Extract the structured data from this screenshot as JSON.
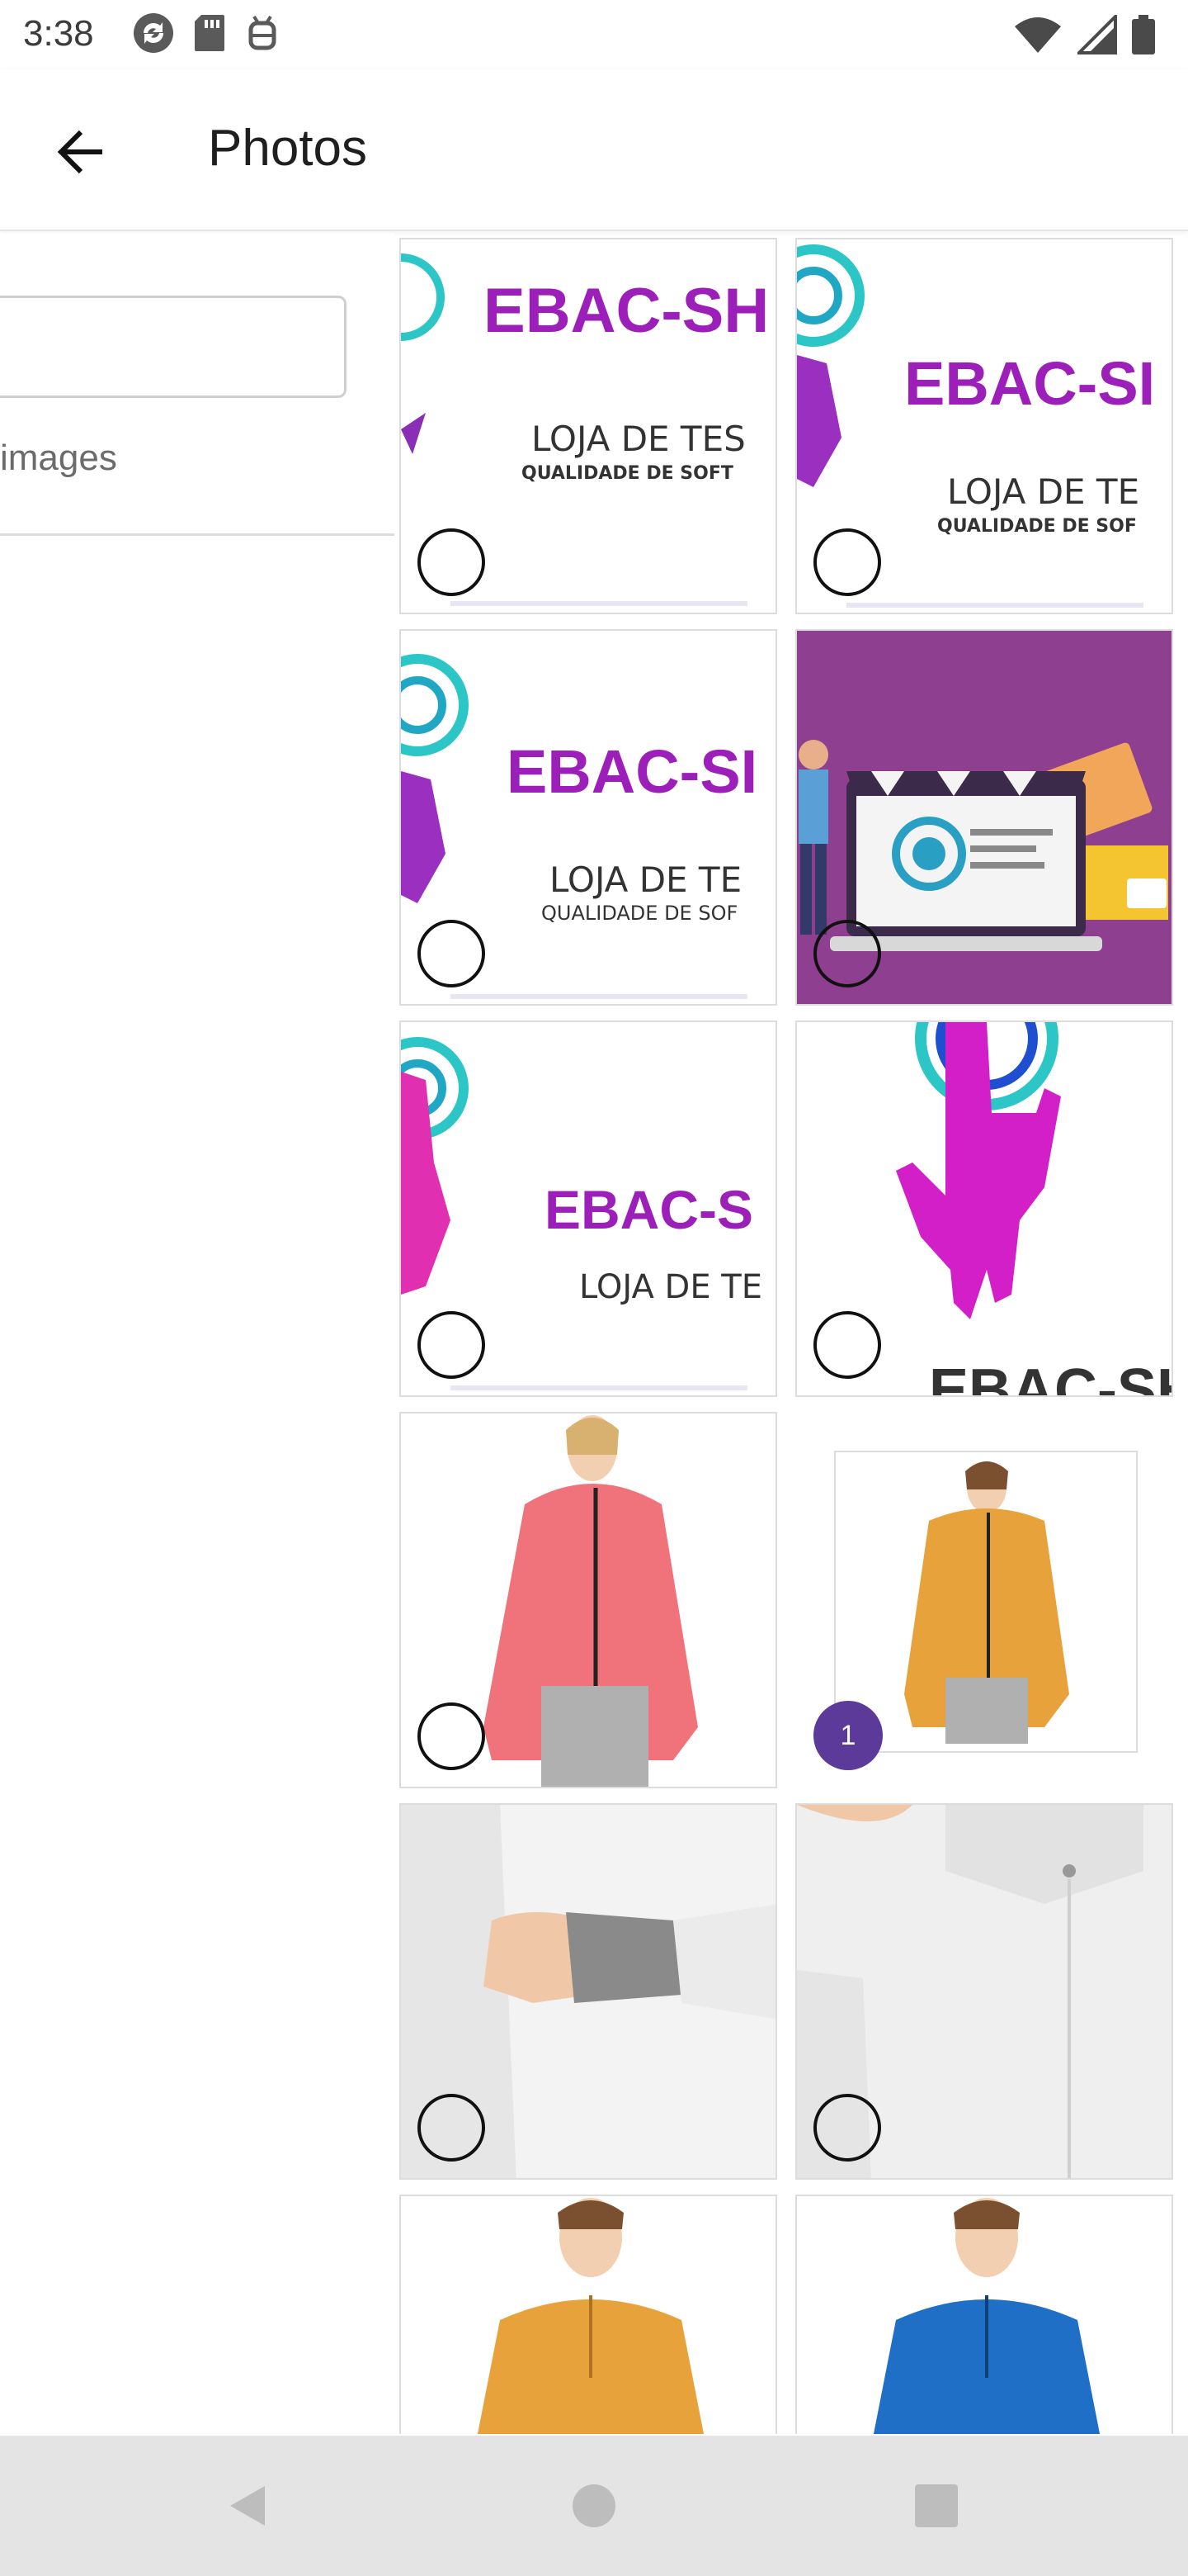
{
  "status_bar": {
    "time": "3:38",
    "left_icons": [
      "sync-icon",
      "sd-card-icon",
      "debug-icon"
    ],
    "right_icons": [
      "wifi-icon",
      "signal-icon",
      "battery-icon"
    ]
  },
  "app_bar": {
    "back_icon": "arrow-back-icon",
    "title": "Photos"
  },
  "left_panel": {
    "search_value": "",
    "images_label": "images"
  },
  "grid": {
    "tiles": [
      {
        "kind": "banner",
        "brand": "EBAC-SH",
        "line1": "LOJA DE TES",
        "line2": "QUALIDADE DE SOFT",
        "selected": false
      },
      {
        "kind": "banner",
        "brand": "EBAC-SI",
        "line1": "LOJA DE TE",
        "line2": "QUALIDADE DE SOF",
        "selected": false
      },
      {
        "kind": "banner",
        "brand": "EBAC-SI",
        "line1": "LOJA DE TE",
        "line2": "QUALIDADE DE SOF",
        "selected": false
      },
      {
        "kind": "store-illustration",
        "selected": false
      },
      {
        "kind": "banner",
        "brand": "EBAC-S",
        "line1": "LOJA DE TE",
        "line2": "",
        "selected": false
      },
      {
        "kind": "hand-logo",
        "brand": "EBAC-SHOP",
        "selected": false
      },
      {
        "kind": "jacket-pink",
        "selected": false
      },
      {
        "kind": "jacket-orange",
        "selected": true,
        "selection_number": "1"
      },
      {
        "kind": "sleeve-detail",
        "selected": false
      },
      {
        "kind": "back-detail",
        "selected": false
      },
      {
        "kind": "pullover-orange",
        "selected": false
      },
      {
        "kind": "pullover-blue",
        "selected": false
      }
    ]
  },
  "nav_bar": {
    "back": "nav-back-icon",
    "home": "nav-home-icon",
    "recents": "nav-recents-icon"
  },
  "colors": {
    "brand_purple": "#9b1fb8",
    "badge_purple": "#5b3a9a",
    "store_bg": "#8e3f8f",
    "jacket_pink": "#f0727a",
    "jacket_orange": "#e8a23b",
    "pullover_blue": "#1f6fc7"
  }
}
